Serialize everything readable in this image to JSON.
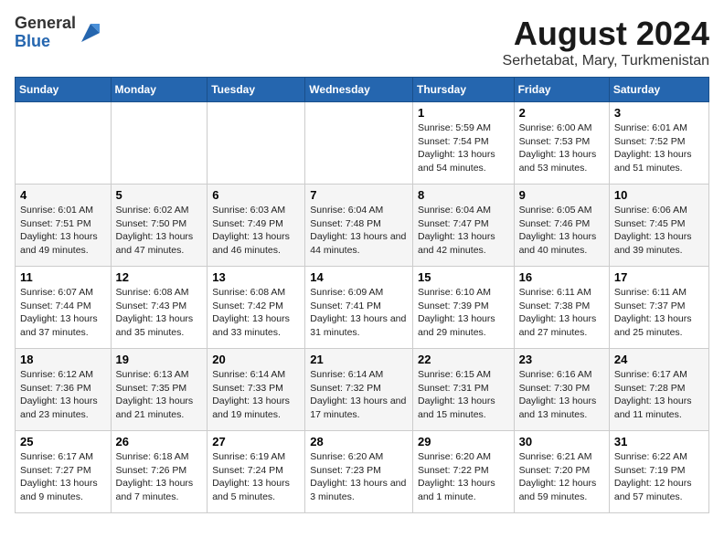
{
  "logo": {
    "general": "General",
    "blue": "Blue"
  },
  "title": "August 2024",
  "subtitle": "Serhetabat, Mary, Turkmenistan",
  "days_of_week": [
    "Sunday",
    "Monday",
    "Tuesday",
    "Wednesday",
    "Thursday",
    "Friday",
    "Saturday"
  ],
  "weeks": [
    [
      {
        "num": "",
        "info": ""
      },
      {
        "num": "",
        "info": ""
      },
      {
        "num": "",
        "info": ""
      },
      {
        "num": "",
        "info": ""
      },
      {
        "num": "1",
        "info": "Sunrise: 5:59 AM\nSunset: 7:54 PM\nDaylight: 13 hours and 54 minutes."
      },
      {
        "num": "2",
        "info": "Sunrise: 6:00 AM\nSunset: 7:53 PM\nDaylight: 13 hours and 53 minutes."
      },
      {
        "num": "3",
        "info": "Sunrise: 6:01 AM\nSunset: 7:52 PM\nDaylight: 13 hours and 51 minutes."
      }
    ],
    [
      {
        "num": "4",
        "info": "Sunrise: 6:01 AM\nSunset: 7:51 PM\nDaylight: 13 hours and 49 minutes."
      },
      {
        "num": "5",
        "info": "Sunrise: 6:02 AM\nSunset: 7:50 PM\nDaylight: 13 hours and 47 minutes."
      },
      {
        "num": "6",
        "info": "Sunrise: 6:03 AM\nSunset: 7:49 PM\nDaylight: 13 hours and 46 minutes."
      },
      {
        "num": "7",
        "info": "Sunrise: 6:04 AM\nSunset: 7:48 PM\nDaylight: 13 hours and 44 minutes."
      },
      {
        "num": "8",
        "info": "Sunrise: 6:04 AM\nSunset: 7:47 PM\nDaylight: 13 hours and 42 minutes."
      },
      {
        "num": "9",
        "info": "Sunrise: 6:05 AM\nSunset: 7:46 PM\nDaylight: 13 hours and 40 minutes."
      },
      {
        "num": "10",
        "info": "Sunrise: 6:06 AM\nSunset: 7:45 PM\nDaylight: 13 hours and 39 minutes."
      }
    ],
    [
      {
        "num": "11",
        "info": "Sunrise: 6:07 AM\nSunset: 7:44 PM\nDaylight: 13 hours and 37 minutes."
      },
      {
        "num": "12",
        "info": "Sunrise: 6:08 AM\nSunset: 7:43 PM\nDaylight: 13 hours and 35 minutes."
      },
      {
        "num": "13",
        "info": "Sunrise: 6:08 AM\nSunset: 7:42 PM\nDaylight: 13 hours and 33 minutes."
      },
      {
        "num": "14",
        "info": "Sunrise: 6:09 AM\nSunset: 7:41 PM\nDaylight: 13 hours and 31 minutes."
      },
      {
        "num": "15",
        "info": "Sunrise: 6:10 AM\nSunset: 7:39 PM\nDaylight: 13 hours and 29 minutes."
      },
      {
        "num": "16",
        "info": "Sunrise: 6:11 AM\nSunset: 7:38 PM\nDaylight: 13 hours and 27 minutes."
      },
      {
        "num": "17",
        "info": "Sunrise: 6:11 AM\nSunset: 7:37 PM\nDaylight: 13 hours and 25 minutes."
      }
    ],
    [
      {
        "num": "18",
        "info": "Sunrise: 6:12 AM\nSunset: 7:36 PM\nDaylight: 13 hours and 23 minutes."
      },
      {
        "num": "19",
        "info": "Sunrise: 6:13 AM\nSunset: 7:35 PM\nDaylight: 13 hours and 21 minutes."
      },
      {
        "num": "20",
        "info": "Sunrise: 6:14 AM\nSunset: 7:33 PM\nDaylight: 13 hours and 19 minutes."
      },
      {
        "num": "21",
        "info": "Sunrise: 6:14 AM\nSunset: 7:32 PM\nDaylight: 13 hours and 17 minutes."
      },
      {
        "num": "22",
        "info": "Sunrise: 6:15 AM\nSunset: 7:31 PM\nDaylight: 13 hours and 15 minutes."
      },
      {
        "num": "23",
        "info": "Sunrise: 6:16 AM\nSunset: 7:30 PM\nDaylight: 13 hours and 13 minutes."
      },
      {
        "num": "24",
        "info": "Sunrise: 6:17 AM\nSunset: 7:28 PM\nDaylight: 13 hours and 11 minutes."
      }
    ],
    [
      {
        "num": "25",
        "info": "Sunrise: 6:17 AM\nSunset: 7:27 PM\nDaylight: 13 hours and 9 minutes."
      },
      {
        "num": "26",
        "info": "Sunrise: 6:18 AM\nSunset: 7:26 PM\nDaylight: 13 hours and 7 minutes."
      },
      {
        "num": "27",
        "info": "Sunrise: 6:19 AM\nSunset: 7:24 PM\nDaylight: 13 hours and 5 minutes."
      },
      {
        "num": "28",
        "info": "Sunrise: 6:20 AM\nSunset: 7:23 PM\nDaylight: 13 hours and 3 minutes."
      },
      {
        "num": "29",
        "info": "Sunrise: 6:20 AM\nSunset: 7:22 PM\nDaylight: 13 hours and 1 minute."
      },
      {
        "num": "30",
        "info": "Sunrise: 6:21 AM\nSunset: 7:20 PM\nDaylight: 12 hours and 59 minutes."
      },
      {
        "num": "31",
        "info": "Sunrise: 6:22 AM\nSunset: 7:19 PM\nDaylight: 12 hours and 57 minutes."
      }
    ]
  ]
}
